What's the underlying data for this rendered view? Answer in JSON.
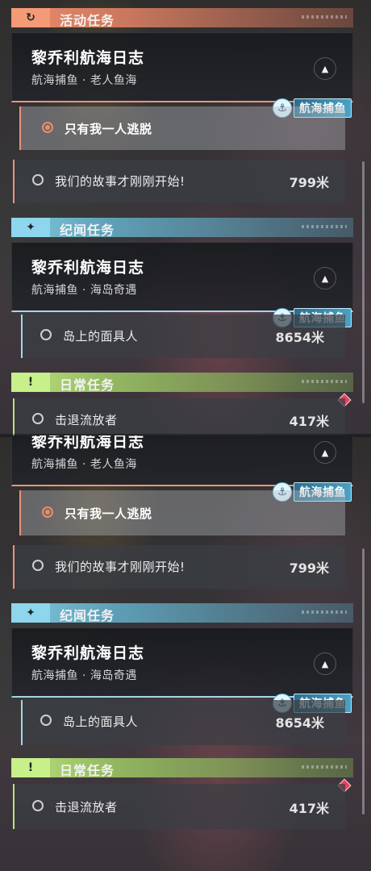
{
  "colors": {
    "activity_accent": "#e98a69",
    "story_accent": "#7ec8de",
    "daily_accent": "#b9e27d",
    "selected_radio": "#f08b68",
    "alert_diamond": "#e5425c"
  },
  "sections": {
    "activity": {
      "label": "活动任务",
      "icon": "refresh-arrow-icon"
    },
    "story": {
      "label": "纪闻任务",
      "icon": "sparkle-star-icon"
    },
    "daily": {
      "label": "日常任务",
      "icon": "exclamation-box-icon"
    }
  },
  "quest_activity": {
    "title": "黎乔利航海日志",
    "subtitle": "航海捕鱼 · 老人鱼海",
    "badge": "航海捕鱼"
  },
  "quest_story": {
    "title": "黎乔利航海日志",
    "subtitle": "航海捕鱼 · 海岛奇遇",
    "badge": "航海捕鱼"
  },
  "objectives": {
    "escape": {
      "label": "只有我一人逃脱"
    },
    "story_begins": {
      "label": "我们的故事才刚刚开始!",
      "distance": "799米"
    },
    "masked_man": {
      "label": "岛上的面具人",
      "distance": "8654米"
    },
    "repel_exiles": {
      "label": "击退流放者",
      "distance": "417米"
    }
  }
}
